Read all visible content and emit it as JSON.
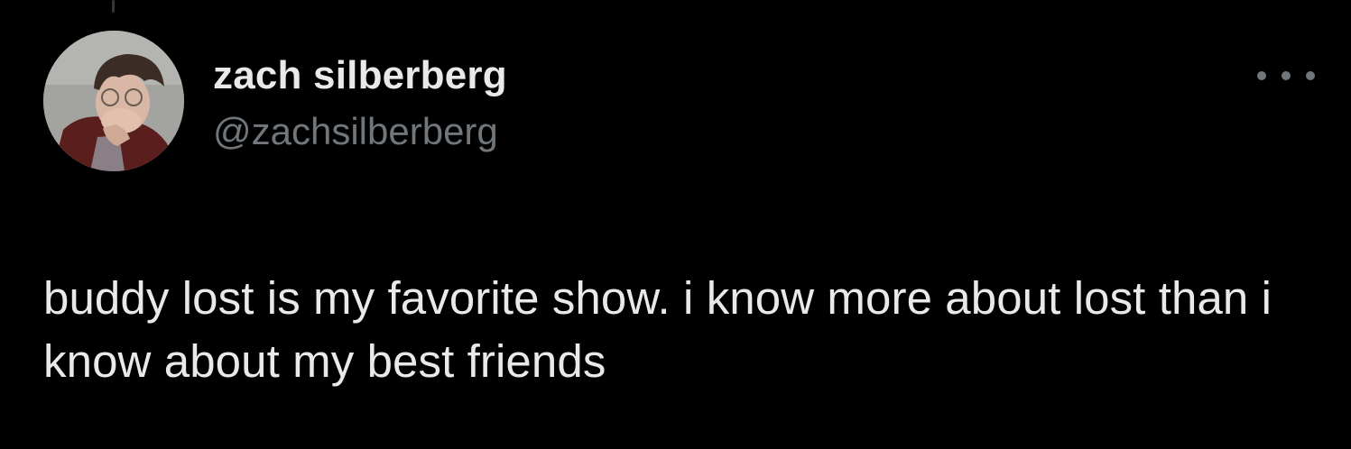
{
  "tweet": {
    "author": {
      "display_name": "zach silberberg",
      "handle": "@zachsilberberg",
      "avatar": "profile-photo"
    },
    "more_icon": "ellipsis-icon",
    "text": "buddy lost is my favorite show. i know more about lost than i know about my best friends"
  },
  "colors": {
    "background": "#000000",
    "primary_text": "#e7e9ea",
    "secondary_text": "#71767b"
  }
}
